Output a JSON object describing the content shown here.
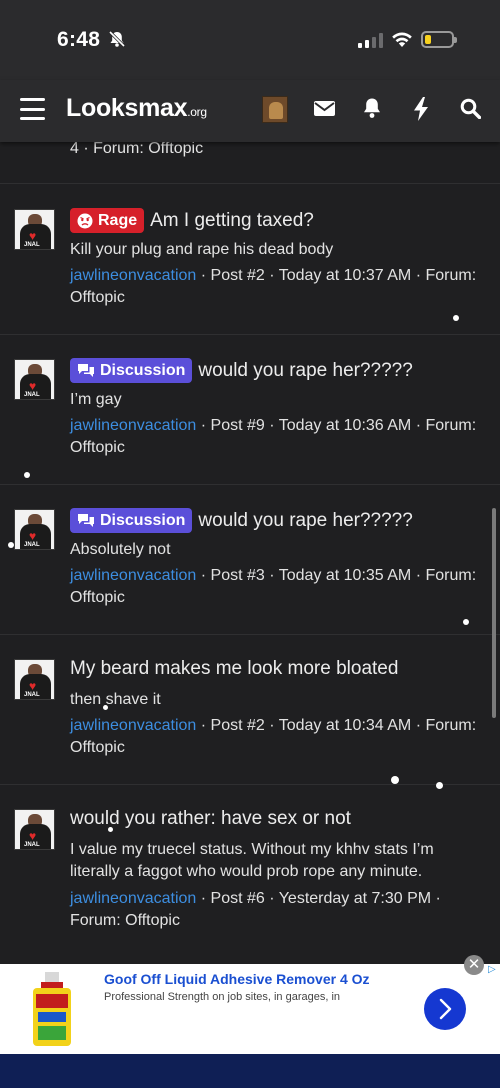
{
  "status_bar": {
    "time": "6:48",
    "battery_level": 0.22
  },
  "nav": {
    "logo_text": "Looksmax",
    "logo_suffix": ".org"
  },
  "partial_line": "4 · Forum: Offtopic",
  "posts": [
    {
      "badge": "Rage",
      "badge_color": "#d6202a",
      "title": "Am I getting taxed?",
      "snippet": "Kill your plug and rape his dead body",
      "author": "jawlineonvacation",
      "meta_rest": " · Post #2 · Today at 10:37 AM · Forum: Offtopic"
    },
    {
      "badge": "Discussion",
      "badge_color": "#5b4fd9",
      "title": "would you rape her?????",
      "snippet": "I’m gay",
      "author": "jawlineonvacation",
      "meta_rest": " · Post #9 · Today at 10:36 AM · Forum: Offtopic"
    },
    {
      "badge": "Discussion",
      "badge_color": "#5b4fd9",
      "title": "would you rape her?????",
      "snippet": "Absolutely not",
      "author": "jawlineonvacation",
      "meta_rest": " · Post #3 · Today at 10:35 AM · Forum: Offtopic"
    },
    {
      "title": "My beard makes me look more bloated",
      "snippet": "then shave it",
      "author": "jawlineonvacation",
      "meta_rest": " · Post #2 · Today at 10:34 AM · Forum: Offtopic"
    },
    {
      "title": "would you rather: have sex or not",
      "snippet": "I value my truecel status. Without my khhv stats I’m literally a faggot who would prob rope any minute.",
      "author": "jawlineonvacation",
      "meta_rest": " · Post #6 · Yesterday at 7:30 PM · Forum: Offtopic"
    }
  ],
  "ad": {
    "title": "Goof Off Liquid Adhesive Remover 4 Oz",
    "subtitle": "Professional Strength on job sites, in garages, in",
    "close_symbol": "✕",
    "info_symbol": "▷",
    "brand_color": "#1538d1"
  }
}
